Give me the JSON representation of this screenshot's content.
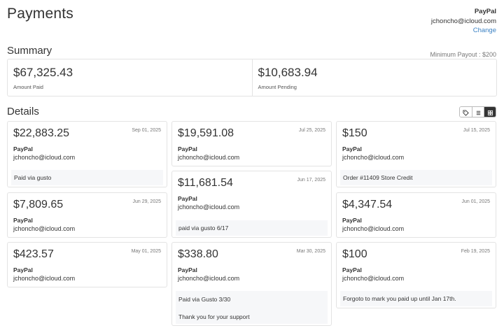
{
  "page_title": "Payments",
  "account": {
    "method": "PayPal",
    "email": "jchoncho@icloud.com",
    "change_label": "Change"
  },
  "summary": {
    "title": "Summary",
    "minimum_payout": "Minimum Payout : $200",
    "amount_paid": {
      "value": "$67,325.43",
      "label": "Amount Paid"
    },
    "amount_pending": {
      "value": "$10,683.94",
      "label": "Amount Pending"
    }
  },
  "details": {
    "title": "Details",
    "view_modes": [
      {
        "icon": "tag-icon",
        "active": false
      },
      {
        "icon": "list-icon",
        "active": false
      },
      {
        "icon": "grid-icon",
        "active": true
      }
    ],
    "cards": [
      {
        "amount": "$22,883.25",
        "date": "Sep 01, 2025",
        "method": "PayPal",
        "email": "jchoncho@icloud.com",
        "note": [
          "Paid via gusto"
        ]
      },
      {
        "amount": "$19,591.08",
        "date": "Jul 25, 2025",
        "method": "PayPal",
        "email": "jchoncho@icloud.com",
        "note": []
      },
      {
        "amount": "$150",
        "date": "Jul 15, 2025",
        "method": "PayPal",
        "email": "jchoncho@icloud.com",
        "note": [
          "Order #11409 Store Credit"
        ]
      },
      {
        "amount": "$7,809.65",
        "date": "Jun 29, 2025",
        "method": "PayPal",
        "email": "jchoncho@icloud.com",
        "note": []
      },
      {
        "amount": "$11,681.54",
        "date": "Jun 17, 2025",
        "method": "PayPal",
        "email": "jchoncho@icloud.com",
        "note": [
          "paid via gusto 6/17"
        ]
      },
      {
        "amount": "$4,347.54",
        "date": "Jun 01, 2025",
        "method": "PayPal",
        "email": "jchoncho@icloud.com",
        "note": []
      },
      {
        "amount": "$423.57",
        "date": "May 01, 2025",
        "method": "PayPal",
        "email": "jchoncho@icloud.com",
        "note": []
      },
      {
        "amount": "$338.80",
        "date": "Mar 30, 2025",
        "method": "PayPal",
        "email": "jchoncho@icloud.com",
        "note": [
          "Paid via Gusto 3/30",
          "",
          "Thank you for your support"
        ]
      },
      {
        "amount": "$100",
        "date": "Feb 19, 2025",
        "method": "PayPal",
        "email": "jchoncho@icloud.com",
        "note": [
          "Forgoto to mark you paid up until Jan 17th."
        ]
      }
    ]
  }
}
